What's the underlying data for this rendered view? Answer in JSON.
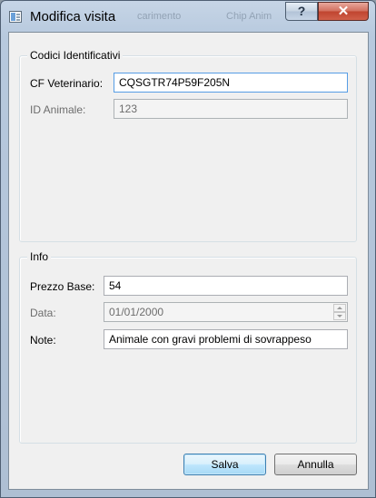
{
  "window": {
    "title": "Modifica visita",
    "background_title_ghosts": [
      "carimento",
      "Chip Anim"
    ]
  },
  "titlebar_buttons": {
    "help": "?",
    "close": "✕"
  },
  "groups": {
    "codici": {
      "title": "Codici Identificativi",
      "cf_label": "CF Veterinario:",
      "cf_value": "CQSGTR74P59F205N",
      "id_label": "ID Animale:",
      "id_value": "123"
    },
    "info": {
      "title": "Info",
      "prezzo_label": "Prezzo Base:",
      "prezzo_value": "54",
      "data_label": "Data:",
      "data_value": "01/01/2000",
      "note_label": "Note:",
      "note_value": "Animale con gravi problemi di sovrappeso"
    }
  },
  "buttons": {
    "save": "Salva",
    "cancel": "Annulla"
  }
}
